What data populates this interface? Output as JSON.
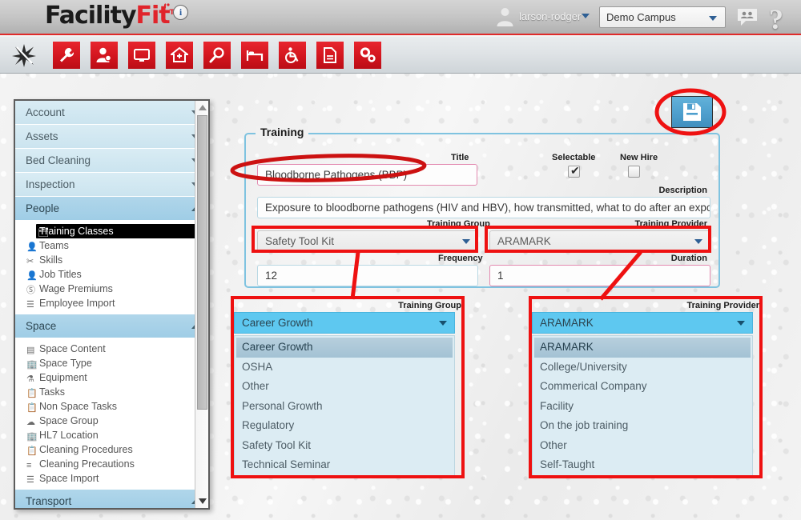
{
  "app": {
    "brand_primary": "Facility",
    "brand_accent": "Fit",
    "brand_tm": "TM",
    "accent_color": "#e0242b",
    "info_icon_glyph": "i"
  },
  "header": {
    "username": "larson-rodger",
    "user_caret": "chevron-down-icon",
    "campus_value": "Demo Campus",
    "campus_caret": "chevron-down-icon",
    "avatar_icon": "user-avatar-icon",
    "people_icon": "people-chat-icon",
    "help_icon": "?"
  },
  "toolbar": {
    "items": [
      {
        "name": "star-burst-icon",
        "label": "Favorites"
      },
      {
        "name": "wrench-icon",
        "label": "Maintenance"
      },
      {
        "name": "person-gear-icon",
        "label": "People"
      },
      {
        "name": "monitor-icon",
        "label": "Displays"
      },
      {
        "name": "home-plus-icon",
        "label": "Facility"
      },
      {
        "name": "magnifier-icon",
        "label": "Search"
      },
      {
        "name": "bed-icon",
        "label": "Bed Cleaning"
      },
      {
        "name": "wheelchair-icon",
        "label": "Transport"
      },
      {
        "name": "document-icon",
        "label": "Reports"
      },
      {
        "name": "gears-icon",
        "label": "Settings"
      }
    ]
  },
  "sidebar": {
    "groups": [
      {
        "label": "Account",
        "expanded": false,
        "items": []
      },
      {
        "label": "Assets",
        "expanded": false,
        "items": []
      },
      {
        "label": "Bed Cleaning",
        "expanded": false,
        "items": []
      },
      {
        "label": "Inspection",
        "expanded": false,
        "items": []
      },
      {
        "label": "People",
        "expanded": true,
        "items": [
          {
            "label": "Training Classes",
            "icon": "id-card-icon",
            "active": true
          },
          {
            "label": "Teams",
            "icon": "person-icon",
            "active": false
          },
          {
            "label": "Skills",
            "icon": "tools-icon",
            "active": false
          },
          {
            "label": "Job Titles",
            "icon": "person-icon",
            "active": false
          },
          {
            "label": "Wage Premiums",
            "icon": "dollar-coin-icon",
            "active": false
          },
          {
            "label": "Employee Import",
            "icon": "stack-icon",
            "active": false
          }
        ]
      },
      {
        "label": "Space",
        "expanded": true,
        "items": [
          {
            "label": "Space Content",
            "icon": "drawer-icon",
            "active": false
          },
          {
            "label": "Space Type",
            "icon": "building-icon",
            "active": false
          },
          {
            "label": "Equipment",
            "icon": "equipment-icon",
            "active": false
          },
          {
            "label": "Tasks",
            "icon": "clipboard-icon",
            "active": false
          },
          {
            "label": "Non Space Tasks",
            "icon": "clipboard-icon",
            "active": false
          },
          {
            "label": "Space Group",
            "icon": "cloud-icon",
            "active": false
          },
          {
            "label": "HL7 Location",
            "icon": "building-icon",
            "active": false
          },
          {
            "label": "Cleaning Procedures",
            "icon": "clipboard-icon",
            "active": false
          },
          {
            "label": "Cleaning Precautions",
            "icon": "list-icon",
            "active": false
          },
          {
            "label": "Space Import",
            "icon": "stack-icon",
            "active": false
          }
        ]
      },
      {
        "label": "Transport",
        "expanded": true,
        "items": []
      }
    ],
    "scrollbar": {
      "up_arrow": "triangle-up-icon",
      "down_arrow": "triangle-down-icon"
    }
  },
  "form": {
    "legend": "Training",
    "title_label": "Title",
    "title_value": "Bloodborne Pathogens (BBP)",
    "selectable_label": "Selectable",
    "selectable_checked": true,
    "selectable_mark": "✔",
    "newhire_label": "New Hire",
    "newhire_checked": false,
    "description_label": "Description",
    "description_value": "Exposure to bloodborne pathogens (HIV and HBV), how transmitted, what to do after an exposure in",
    "training_group_label": "Training Group",
    "training_group_value": "Safety Tool Kit",
    "training_provider_label": "Training Provider",
    "training_provider_value": "ARAMARK",
    "frequency_label": "Frequency",
    "frequency_value": "12",
    "duration_label": "Duration",
    "duration_value": "1",
    "save_button_icon": "save-floppy-icon",
    "save_button_label": "Save"
  },
  "dropdown_group": {
    "label": "Training Group",
    "selected": "Career Growth",
    "caret": "chevron-down-icon",
    "options": [
      "Career Growth",
      "OSHA",
      "Other",
      "Personal Growth",
      "Regulatory",
      "Safety Tool Kit",
      "Technical Seminar"
    ]
  },
  "dropdown_provider": {
    "label": "Training Provider",
    "selected": "ARAMARK",
    "caret": "chevron-down-icon",
    "options": [
      "ARAMARK",
      "College/University",
      "Commerical Company",
      "Facility",
      "On the job training",
      "Other",
      "Self-Taught"
    ]
  },
  "annotations": {
    "color": "#ee1111",
    "shapes": [
      "ellipse-around-save-button",
      "ellipse-around-title-field",
      "box-around-training-group-select",
      "box-around-training-provider-select",
      "box-around-group-dropdown-list",
      "box-around-provider-dropdown-list",
      "connector-line-group",
      "connector-line-provider"
    ]
  }
}
